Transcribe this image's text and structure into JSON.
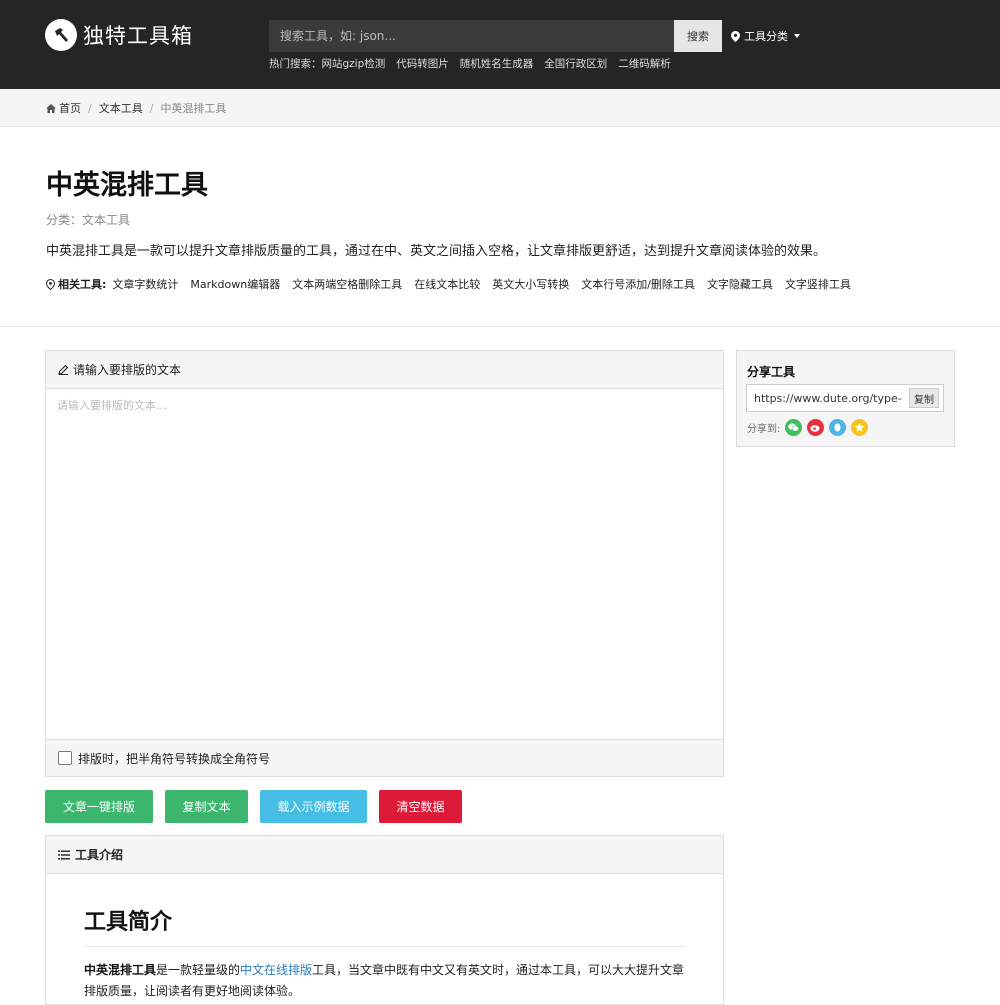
{
  "header": {
    "logo_text": "独特工具箱",
    "search_placeholder": "搜索工具，如: json...",
    "search_button": "搜索",
    "category_menu": "工具分类",
    "hot_label": "热门搜索：",
    "hot_links": [
      "网站gzip检测",
      "代码转图片",
      "随机姓名生成器",
      "全国行政区划",
      "二维码解析"
    ]
  },
  "breadcrumb": {
    "home": "首页",
    "section": "文本工具",
    "current": "中英混排工具"
  },
  "hero": {
    "title": "中英混排工具",
    "category": "分类：文本工具",
    "description": "中英混排工具是一款可以提升文章排版质量的工具，通过在中、英文之间插入空格，让文章排版更舒适，达到提升文章阅读体验的效果。",
    "related_label": "相关工具:",
    "related_links": [
      "文章字数统计",
      "Markdown编辑器",
      "文本两端空格删除工具",
      "在线文本比较",
      "英文大小写转换",
      "文本行号添加/删除工具",
      "文字隐藏工具",
      "文字竖排工具"
    ]
  },
  "editor": {
    "header": "请输入要排版的文本",
    "placeholder": "请输入要排版的文本...",
    "option_label": "排版时，把半角符号转换成全角符号"
  },
  "buttons": {
    "format": "文章一键排版",
    "copy": "复制文本",
    "load_sample": "载入示例数据",
    "clear": "清空数据"
  },
  "intro": {
    "header": "工具介绍",
    "title": "工具简介",
    "text_bold": "中英混排工具",
    "text_1": "是一款轻量级的",
    "text_link": "中文在线排版",
    "text_2": "工具，当文章中既有中文又有英文时，通过本工具，可以大大提升文章排版质量，让阅读者有更好地阅读体验。"
  },
  "share": {
    "title": "分享工具",
    "url": "https://www.dute.org/type-set",
    "copy_button": "复制",
    "share_to": "分享到:"
  },
  "colors": {
    "header_bg": "#252525",
    "green": "#3cb56d",
    "blue": "#45bde4",
    "red": "#dd1a37",
    "link": "#2a7bbd"
  }
}
